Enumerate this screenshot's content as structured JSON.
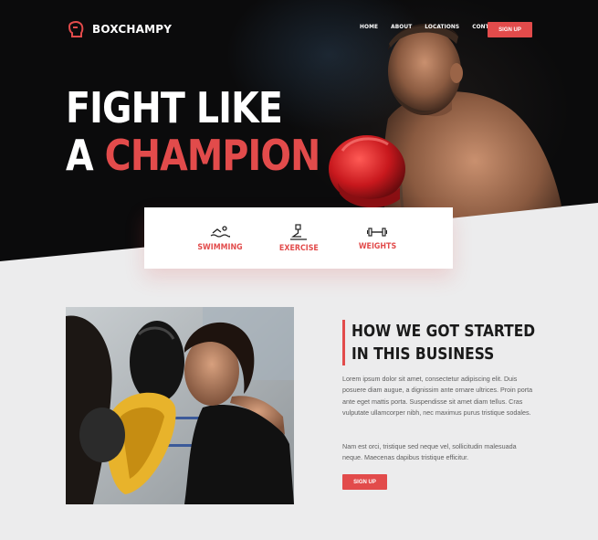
{
  "brand": {
    "name": "BOXCHAMPY"
  },
  "nav": {
    "items": [
      "HOME",
      "ABOUT",
      "LOCATIONS",
      "CONTACT"
    ],
    "cta": "SIGN UP"
  },
  "hero": {
    "line1": "FIGHT LIKE",
    "line2_a": "A",
    "line2_b": "CHAMPION"
  },
  "features": [
    {
      "label": "SWIMMING",
      "icon": "swimmer-icon"
    },
    {
      "label": "EXERCISE",
      "icon": "exercise-icon"
    },
    {
      "label": "WEIGHTS",
      "icon": "dumbbell-icon"
    }
  ],
  "about": {
    "title_line1": "HOW WE GOT STARTED",
    "title_line2": "IN THIS BUSINESS",
    "paragraph1": "Lorem ipsum dolor sit amet, consectetur adipiscing elit. Duis posuere diam augue, a dignissim ante ornare ultrices. Proin porta ante eget mattis porta. Suspendisse sit amet diam tellus. Cras vulputate ullamcorper nibh, nec maximus purus tristique sodales.",
    "paragraph2": "Nam est orci, tristique sed neque vel, sollicitudin malesuada neque. Maecenas dapibus tristique efficitur.",
    "cta": "SIGN UP"
  },
  "colors": {
    "accent": "#e24b4b",
    "dark": "#0b0b0c",
    "background": "#ececed"
  }
}
